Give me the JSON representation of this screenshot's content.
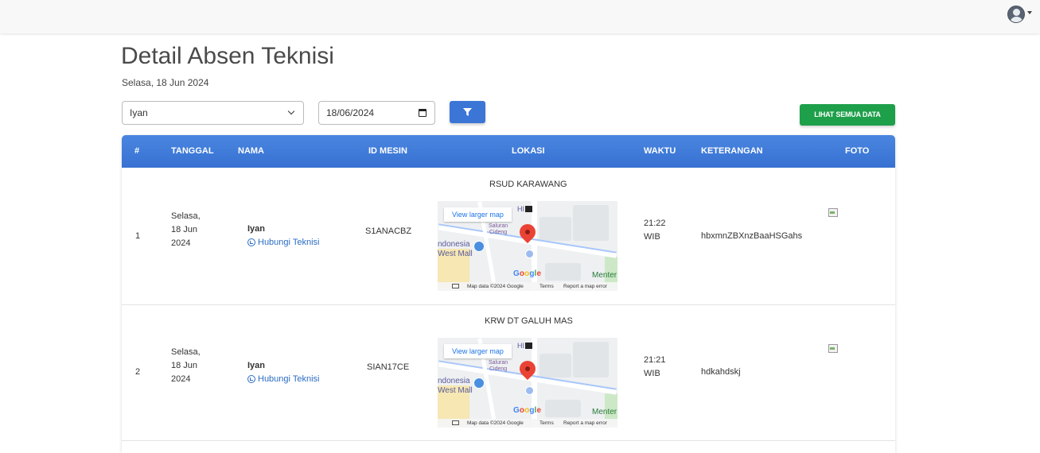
{
  "header": {
    "avatar_icon": "user-avatar-icon"
  },
  "page": {
    "title": "Detail Absen Teknisi",
    "date": "Selasa, 18 Jun 2024"
  },
  "filters": {
    "technician_value": "Iyan",
    "date_value": "18/06/2024",
    "filter_icon": "filter-icon",
    "show_all_label": "LIHAT SEMUA DATA"
  },
  "colors": {
    "primary": "#3b75d6",
    "success": "#1e9f4a",
    "table_header": "#4a86e0"
  },
  "table": {
    "columns": [
      "#",
      "TANGGAL",
      "NAMA",
      "ID MESIN",
      "LOKASI",
      "WAKTU",
      "KETERANGAN",
      "FOTO"
    ],
    "rows": [
      {
        "no": "1",
        "date_line1": "Selasa,",
        "date_line2": "18 Jun",
        "date_line3": "2024",
        "name": "Iyan",
        "contact_label": "Hubungi Teknisi",
        "machine_id": "S1ANACBZ",
        "location": "RSUD KARAWANG",
        "time_line1": "21:22",
        "time_line2": "WIB",
        "note": "hbxmnZBXnzBaaHSGahs"
      },
      {
        "no": "2",
        "date_line1": "Selasa,",
        "date_line2": "18 Jun",
        "date_line3": "2024",
        "name": "Iyan",
        "contact_label": "Hubungi Teknisi",
        "machine_id": "SIAN17CE",
        "location": "KRW DT GALUH MAS",
        "time_line1": "21:21",
        "time_line2": "WIB",
        "note": "hdkahdskj"
      }
    ]
  },
  "map": {
    "view_larger": "View larger map",
    "area_label_1": "ndonesia",
    "area_label_2": "West Mall",
    "street_label_1": "Saluran",
    "street_label_2": "Cideng",
    "hi_label": "HI",
    "menteng": "Menter",
    "google_label": "Google",
    "map_data": "Map data ©2024 Google",
    "terms": "Terms",
    "report": "Report a map error"
  }
}
